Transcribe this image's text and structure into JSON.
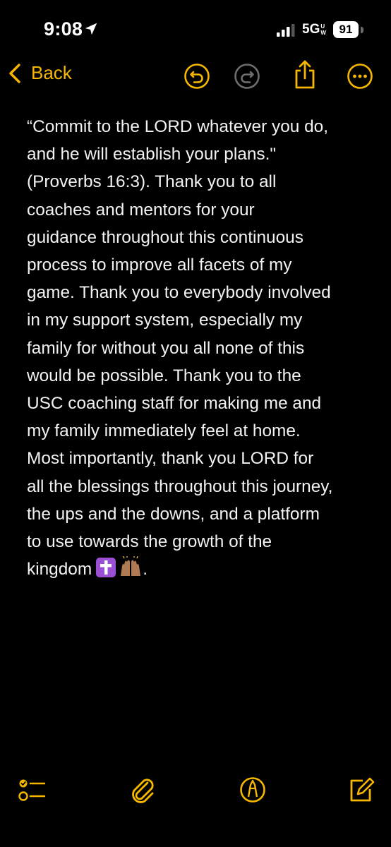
{
  "status_bar": {
    "time": "9:08",
    "network": "5G",
    "network_suffix_top": "U",
    "network_suffix_bottom": "W",
    "battery": "91"
  },
  "nav": {
    "back_label": "Back",
    "ghost_title": "",
    "accent_color": "#f5b700"
  },
  "note": {
    "text_before_emoji": "“Commit to the LORD whatever you do,\nand he will establish your plans.\"\n(Proverbs 16:3). Thank you to all\ncoaches and mentors for your\nguidance throughout this continuous\nprocess to improve all facets of my\ngame. Thank you to everybody involved\nin my support system, especially my\nfamily for without you all none of this\nwould be possible. Thank you to the\nUSC coaching staff for making me and\nmy family immediately feel at home.\nMost importantly, thank you LORD for\nall the blessings throughout this journey,\nthe ups and the downs, and a platform\nto use towards the growth of the\nkingdom",
    "emojis": [
      "latin-cross-emoji",
      "raising-hands-emoji"
    ],
    "text_after_emoji": "."
  },
  "toolbar": {
    "icons": [
      "checklist-icon",
      "paperclip-icon",
      "markup-pen-icon",
      "compose-icon"
    ]
  }
}
